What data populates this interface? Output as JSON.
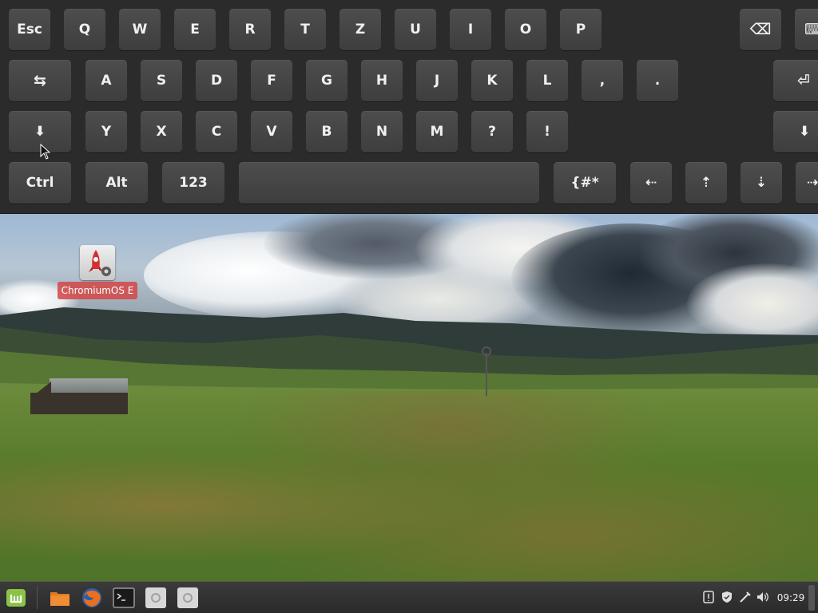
{
  "keyboard": {
    "row1": [
      {
        "label": "Esc",
        "name": "key-esc"
      },
      {
        "label": "Q",
        "name": "key-q"
      },
      {
        "label": "W",
        "name": "key-w"
      },
      {
        "label": "E",
        "name": "key-e"
      },
      {
        "label": "R",
        "name": "key-r"
      },
      {
        "label": "T",
        "name": "key-t"
      },
      {
        "label": "Z",
        "name": "key-z"
      },
      {
        "label": "U",
        "name": "key-u"
      },
      {
        "label": "I",
        "name": "key-i"
      },
      {
        "label": "O",
        "name": "key-o"
      },
      {
        "label": "P",
        "name": "key-p"
      },
      {
        "label": "⌫",
        "name": "key-backspace"
      },
      {
        "label": "⌨",
        "name": "key-keyboard-icon"
      }
    ],
    "row2": [
      {
        "label": "⇆",
        "name": "key-tab"
      },
      {
        "label": "A",
        "name": "key-a"
      },
      {
        "label": "S",
        "name": "key-s"
      },
      {
        "label": "D",
        "name": "key-d"
      },
      {
        "label": "F",
        "name": "key-f"
      },
      {
        "label": "G",
        "name": "key-g"
      },
      {
        "label": "H",
        "name": "key-h"
      },
      {
        "label": "J",
        "name": "key-j"
      },
      {
        "label": "K",
        "name": "key-k"
      },
      {
        "label": "L",
        "name": "key-l"
      },
      {
        "label": ",",
        "name": "key-comma"
      },
      {
        "label": ".",
        "name": "key-period"
      },
      {
        "label": "⏎",
        "name": "key-enter"
      }
    ],
    "row3": [
      {
        "label": "⬇",
        "name": "key-shift-left"
      },
      {
        "label": "Y",
        "name": "key-y"
      },
      {
        "label": "X",
        "name": "key-x"
      },
      {
        "label": "C",
        "name": "key-c"
      },
      {
        "label": "V",
        "name": "key-v"
      },
      {
        "label": "B",
        "name": "key-b"
      },
      {
        "label": "N",
        "name": "key-n"
      },
      {
        "label": "M",
        "name": "key-m"
      },
      {
        "label": "?",
        "name": "key-question"
      },
      {
        "label": "!",
        "name": "key-exclamation"
      },
      {
        "label": "⬇",
        "name": "key-shift-right"
      }
    ],
    "row4": [
      {
        "label": "Ctrl",
        "name": "key-ctrl"
      },
      {
        "label": "Alt",
        "name": "key-alt"
      },
      {
        "label": "123",
        "name": "key-numbers"
      },
      {
        "label": "",
        "name": "key-space"
      },
      {
        "label": "{#*",
        "name": "key-symbols"
      },
      {
        "label": "⇠",
        "name": "key-arrow-left"
      },
      {
        "label": "⇡",
        "name": "key-arrow-up"
      },
      {
        "label": "⇣",
        "name": "key-arrow-down"
      },
      {
        "label": "⇢",
        "name": "key-arrow-right"
      }
    ]
  },
  "desktop": {
    "icon_label": "ChromiumOS E"
  },
  "taskbar": {
    "menu_icon": "mint-menu-icon",
    "launchers": [
      "folder-icon",
      "firefox-icon",
      "terminal-icon",
      "app-icon",
      "app-icon"
    ],
    "tray": [
      "update-manager-icon",
      "shield-icon",
      "network-icon",
      "volume-icon"
    ],
    "clock": "09:29"
  },
  "colors": {
    "keyboard_bg": "#2b2b2b",
    "key_bg": "#474747",
    "icon_label_bg": "#d24646",
    "taskbar_bg": "#2a2a2a",
    "mint_green": "#8bc34a"
  }
}
